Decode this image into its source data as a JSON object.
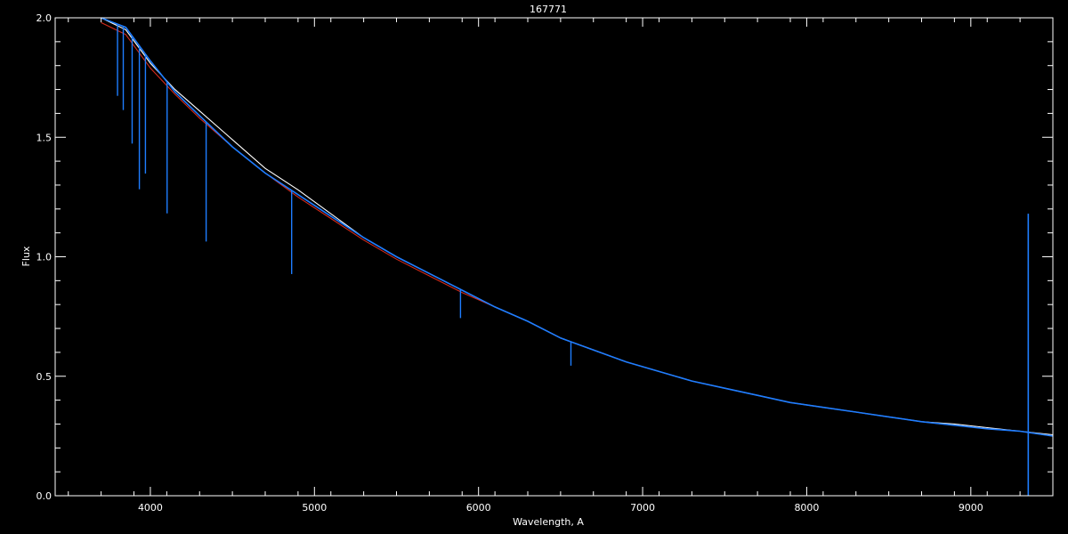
{
  "chart_data": {
    "type": "line",
    "title": "167771",
    "xlabel": "Wavelength, A",
    "ylabel": "Flux",
    "xlim": [
      3420,
      9500
    ],
    "ylim": [
      0,
      2
    ],
    "xticks": [
      {
        "value": 4000,
        "label": "4000"
      },
      {
        "value": 5000,
        "label": "5000"
      },
      {
        "value": 6000,
        "label": "6000"
      },
      {
        "value": 7000,
        "label": "7000"
      },
      {
        "value": 8000,
        "label": "8000"
      },
      {
        "value": 9000,
        "label": "9000"
      }
    ],
    "yticks": [
      {
        "value": 0.0,
        "label": "0.0"
      },
      {
        "value": 0.5,
        "label": "0.5"
      },
      {
        "value": 1.0,
        "label": "1.0"
      },
      {
        "value": 1.5,
        "label": "1.5"
      },
      {
        "value": 2.0,
        "label": "2.0"
      }
    ],
    "grid": false,
    "colors": {
      "background": "#000000",
      "axes": "#ffffff",
      "observed": "#ffffff",
      "model": "#1e7dff",
      "fit": "#d42a1c"
    },
    "series": [
      {
        "color": "#ffffff",
        "x": [
          3700,
          3850,
          4000,
          4150,
          4300,
          4500,
          4700,
          4900,
          5100,
          5300,
          5500,
          5700,
          5900,
          6100,
          6300,
          6500,
          6700,
          6900,
          7100,
          7300,
          7500,
          7700,
          7900,
          8100,
          8300,
          8500,
          8700,
          8900,
          9100,
          9300,
          9500
        ],
        "values": [
          2.0,
          1.95,
          1.81,
          1.7,
          1.61,
          1.49,
          1.37,
          1.28,
          1.18,
          1.08,
          1.0,
          0.93,
          0.86,
          0.79,
          0.73,
          0.66,
          0.61,
          0.56,
          0.52,
          0.48,
          0.45,
          0.42,
          0.39,
          0.37,
          0.35,
          0.33,
          0.31,
          0.3,
          0.285,
          0.27,
          0.255
        ]
      },
      {
        "color": "#d42a1c",
        "x": [
          3700,
          3850,
          4000,
          4150,
          4300,
          4500,
          4700,
          4900,
          5100,
          5300,
          5500,
          5700,
          5900,
          6100,
          6300,
          6500,
          6700,
          6900,
          7100,
          7300,
          7500,
          7700,
          7900,
          8100,
          8300,
          8500,
          8700,
          8900,
          9100,
          9300,
          9500
        ],
        "values": [
          1.98,
          1.93,
          1.79,
          1.68,
          1.58,
          1.46,
          1.35,
          1.25,
          1.16,
          1.07,
          0.99,
          0.92,
          0.85,
          0.79,
          0.73,
          0.66,
          0.61,
          0.56,
          0.52,
          0.48,
          0.45,
          0.42,
          0.39,
          0.37,
          0.35,
          0.33,
          0.31,
          0.295,
          0.28,
          0.27,
          0.25
        ]
      },
      {
        "color": "#1e7dff",
        "x": [
          3700,
          3850,
          4000,
          4150,
          4300,
          4500,
          4700,
          4900,
          5100,
          5300,
          5500,
          5700,
          5900,
          6100,
          6300,
          6500,
          6700,
          6900,
          7100,
          7300,
          7500,
          7700,
          7900,
          8100,
          8300,
          8500,
          8700,
          8900,
          9100,
          9300,
          9500
        ],
        "values": [
          2.0,
          1.96,
          1.82,
          1.69,
          1.59,
          1.46,
          1.35,
          1.26,
          1.17,
          1.08,
          1.0,
          0.93,
          0.86,
          0.79,
          0.73,
          0.66,
          0.61,
          0.56,
          0.52,
          0.48,
          0.45,
          0.42,
          0.39,
          0.37,
          0.35,
          0.33,
          0.31,
          0.295,
          0.28,
          0.27,
          0.25
        ]
      }
    ],
    "absorption_lines": [
      {
        "x": 3800,
        "depth": 0.3
      },
      {
        "x": 3835,
        "depth": 0.35
      },
      {
        "x": 3889,
        "depth": 0.45
      },
      {
        "x": 3933,
        "depth": 0.6
      },
      {
        "x": 3970,
        "depth": 0.5
      },
      {
        "x": 4102,
        "depth": 0.55
      },
      {
        "x": 4340,
        "depth": 0.5
      },
      {
        "x": 4861,
        "depth": 0.35
      },
      {
        "x": 5890,
        "depth": 0.12
      },
      {
        "x": 6563,
        "depth": 0.1
      }
    ],
    "emission_spike": {
      "x": 9350,
      "peak": 1.18
    }
  }
}
